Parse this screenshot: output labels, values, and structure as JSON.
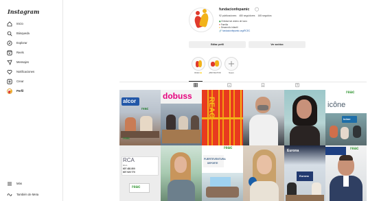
{
  "app": {
    "logo": "Instagram"
  },
  "sidebar": {
    "items": [
      {
        "label": "Inicio",
        "icon": "home-icon"
      },
      {
        "label": "Búsqueda",
        "icon": "search-icon"
      },
      {
        "label": "Explorar",
        "icon": "compass-icon"
      },
      {
        "label": "Reels",
        "icon": "reels-icon"
      },
      {
        "label": "Mensajes",
        "icon": "messenger-icon"
      },
      {
        "label": "Notificaciones",
        "icon": "heart-icon"
      },
      {
        "label": "Crear",
        "icon": "plus-square-icon"
      },
      {
        "label": "Perfil",
        "icon": "profile-avatar"
      }
    ],
    "bottom": [
      {
        "label": "Más",
        "icon": "menu-icon"
      },
      {
        "label": "También de Meta",
        "icon": "meta-icon"
      }
    ]
  },
  "profile": {
    "username": "fundacionfepamic",
    "verified_mark": "◯",
    "stats": {
      "posts": "92 publicaciones",
      "followers": "480 seguidores",
      "following": "165 seguidos"
    },
    "bio": [
      "Entidad sin ánimo de lucro",
      "Familia",
      "Desarrollo infantil",
      "fundacionfepamic.org/RCEC"
    ],
    "buttons": {
      "edit": "Editar perfil",
      "archive": "Ver archivo"
    }
  },
  "highlights": [
    {
      "label": "RCEC 🌟"
    },
    {
      "label": "¡PROYECTOS!"
    },
    {
      "label": "Nuevo"
    }
  ],
  "tabs": [
    "posts-grid-icon",
    "reels-icon",
    "saved-icon",
    "tagged-icon"
  ],
  "grid": {
    "row1": [
      "alcor",
      "dobuss",
      "REAC",
      "",
      "",
      "icône"
    ],
    "row2": [
      "RCA",
      "",
      "FUERTEVENTURA",
      "",
      "Eurona",
      "reac"
    ],
    "tile_texts": {
      "t1_big": "alcor",
      "t1_sub": "reac",
      "t1_logo": "reac",
      "t2": "dobuss",
      "t3": "REAC",
      "t6_top": "reac",
      "t6_big": "icône",
      "t6_sub": "icône",
      "t7": "RCA",
      "t7_l1": "RCA",
      "t7_phone1": "607 481 800",
      "t7_phone2": "607 920 770",
      "t7_logo": "reac",
      "t9_logo": "reac",
      "t9_title": "FUERTEVENTURA",
      "t9_sub": "DEPORTE",
      "t11_a": "Eurona",
      "t11_b": "Eurona",
      "t12_logo": "reac",
      "t1_alt": "RCEC"
    }
  },
  "colors": {
    "accent_red": "#e03a2c",
    "accent_yellow": "#f2b31a",
    "link": "#1d5aa8",
    "reac_green": "#3a9a3a"
  }
}
